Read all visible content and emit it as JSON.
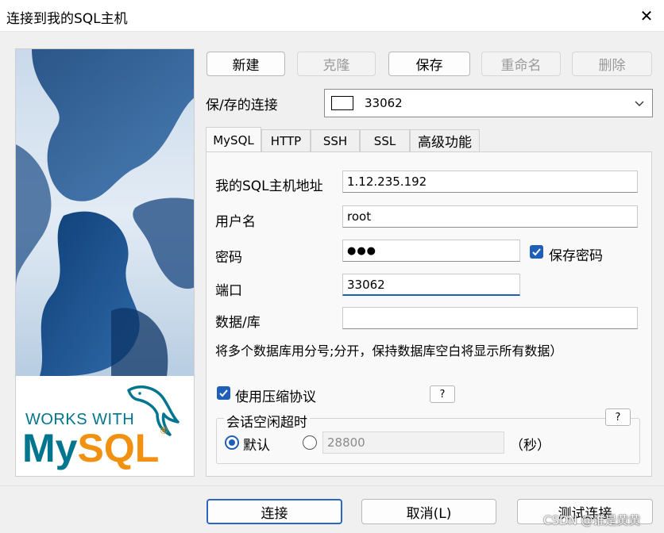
{
  "window": {
    "title": "连接到我的SQL主机",
    "close_glyph": "✕"
  },
  "banner": {
    "works_with": "WORKS WITH",
    "brand_my": "My",
    "brand_sql": "SQL",
    "brand_r": "®"
  },
  "toolbar": {
    "new": "新建",
    "clone": "克隆",
    "save": "保存",
    "rename": "重命名",
    "delete": "删除"
  },
  "saved_connections": {
    "label": "保/存的连接",
    "value": "33062"
  },
  "tabs": [
    "MySQL",
    "HTTP",
    "SSH",
    "SSL",
    "高级功能"
  ],
  "form": {
    "host_label": "我的SQL主机地址",
    "host_value": "1.12.235.192",
    "user_label": "用户名",
    "user_value": "root",
    "password_label": "密码",
    "password_value": "●●●",
    "save_password_label": "保存密码",
    "port_label": "端口",
    "port_value": "33062",
    "database_label": "数据/库",
    "database_value": "",
    "database_hint": "将多个数据库用分号;分开，保持数据库空白将显示所有数据）",
    "compression_label": "使用压缩协议",
    "help_label": "?",
    "idle_group_label": "会话空闲超时",
    "default_label": "默认",
    "timeout_value": "28800",
    "seconds_label": "（秒）"
  },
  "footer": {
    "connect": "连接",
    "cancel": "取消(L)",
    "test": "测试连接"
  },
  "watermark": "CSDN @谁是黄黄",
  "colors": {
    "accent": "#1f5fb8",
    "banner_blue": "#1b4f8a",
    "mysql_blue": "#00758f",
    "mysql_orange": "#f29111"
  }
}
